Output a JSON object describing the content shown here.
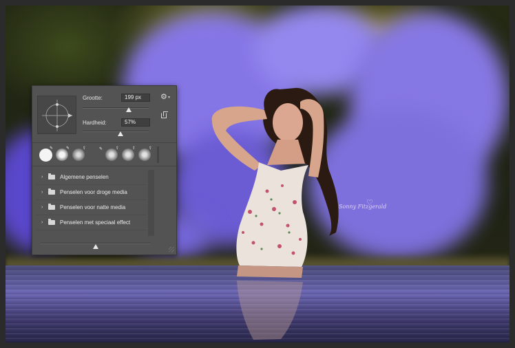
{
  "brush_panel": {
    "size": {
      "label": "Grootte:",
      "value": "199 px",
      "slider_fraction": 0.7
    },
    "hardness": {
      "label": "Hardheid:",
      "value": "57%",
      "slider_fraction": 0.57
    },
    "menu_icon": "gear-icon",
    "new_preset_icon": "new-preset-icon",
    "recent_brushes": [
      {
        "name": "hard-round",
        "badge": "pencil-icon"
      },
      {
        "name": "soft-round",
        "badge": "pencil-icon"
      },
      {
        "name": "soft-round",
        "badge": "upload-icon"
      },
      {
        "name": "empty",
        "badge": "pencil-icon"
      },
      {
        "name": "soft-round",
        "badge": "upload-icon"
      },
      {
        "name": "soft-round",
        "badge": "upload-icon"
      },
      {
        "name": "soft-round",
        "badge": "upload-icon"
      }
    ],
    "groups": [
      {
        "label": "Algemene penselen"
      },
      {
        "label": "Penselen voor droge media"
      },
      {
        "label": "Penselen voor natte media"
      },
      {
        "label": "Penselen met speciaal effect"
      }
    ],
    "preview_zoom_fraction": 0.5
  },
  "photo": {
    "smoke_color": "#7a6ee0",
    "watermark_text": "Sonny Fitzgerald",
    "watermark_heart": "heart-icon"
  }
}
